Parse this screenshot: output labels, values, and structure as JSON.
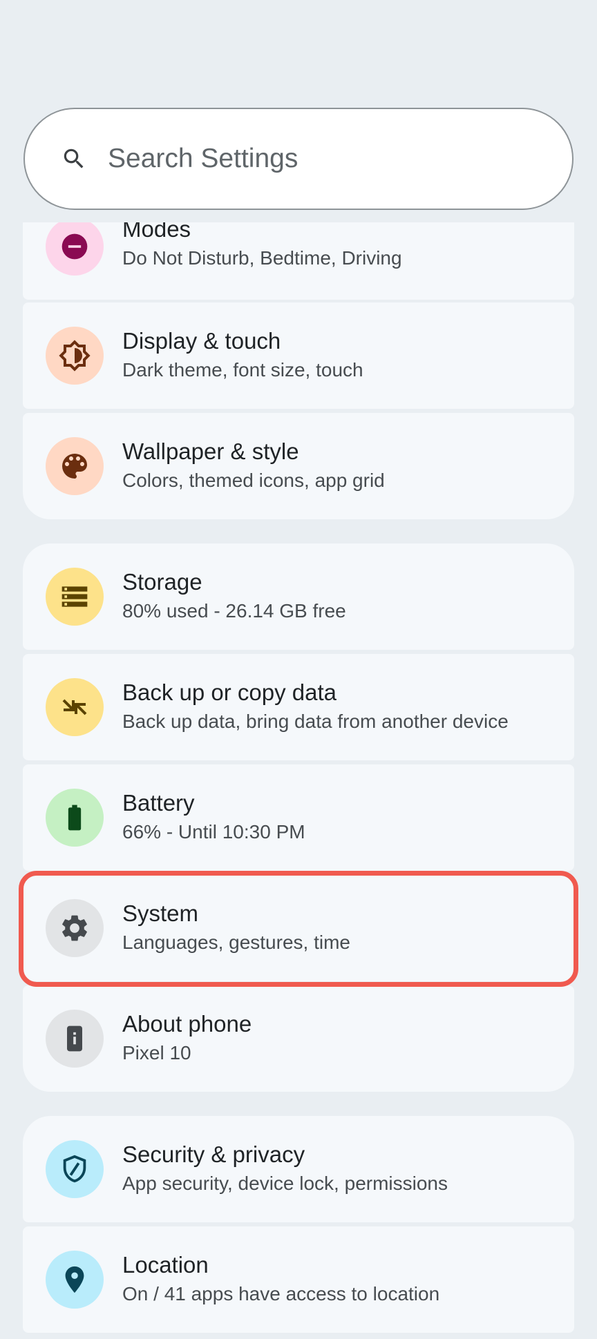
{
  "search": {
    "placeholder": "Search Settings",
    "icon": "search-icon"
  },
  "items": [
    {
      "title": "Modes",
      "subtitle": "Do Not Disturb, Bedtime, Driving",
      "icon": "do-not-disturb-icon",
      "icon_bg": "#fdd5ea",
      "icon_fg": "#8a0a52"
    },
    {
      "title": "Display & touch",
      "subtitle": "Dark theme, font size, touch",
      "icon": "brightness-icon",
      "icon_bg": "#ffd8c4",
      "icon_fg": "#6b2e0f"
    },
    {
      "title": "Wallpaper & style",
      "subtitle": "Colors, themed icons, app grid",
      "icon": "palette-icon",
      "icon_bg": "#ffd8c4",
      "icon_fg": "#6b2e0f"
    },
    {
      "title": "Storage",
      "subtitle": "80% used - 26.14 GB free",
      "icon": "storage-icon",
      "icon_bg": "#fde28a",
      "icon_fg": "#5b4300"
    },
    {
      "title": "Back up or copy data",
      "subtitle": "Back up data, bring data from another device",
      "icon": "backup-icon",
      "icon_bg": "#fde28a",
      "icon_fg": "#5b4300"
    },
    {
      "title": "Battery",
      "subtitle": "66% - Until 10:30 PM",
      "icon": "battery-icon",
      "icon_bg": "#c5f0c3",
      "icon_fg": "#0c4a1a"
    },
    {
      "title": "System",
      "subtitle": "Languages, gestures, time",
      "icon": "gear-icon",
      "icon_bg": "#e2e4e6",
      "icon_fg": "#45494d"
    },
    {
      "title": "About phone",
      "subtitle": "Pixel 10",
      "icon": "info-phone-icon",
      "icon_bg": "#e2e4e6",
      "icon_fg": "#45494d"
    },
    {
      "title": "Security & privacy",
      "subtitle": "App security, device lock, permissions",
      "icon": "shield-icon",
      "icon_bg": "#b9ecfb",
      "icon_fg": "#0b4658"
    },
    {
      "title": "Location",
      "subtitle": "On / 41 apps have access to location",
      "icon": "location-icon",
      "icon_bg": "#b9ecfb",
      "icon_fg": "#0b4658"
    }
  ],
  "highlight_color": "#f05a4f"
}
